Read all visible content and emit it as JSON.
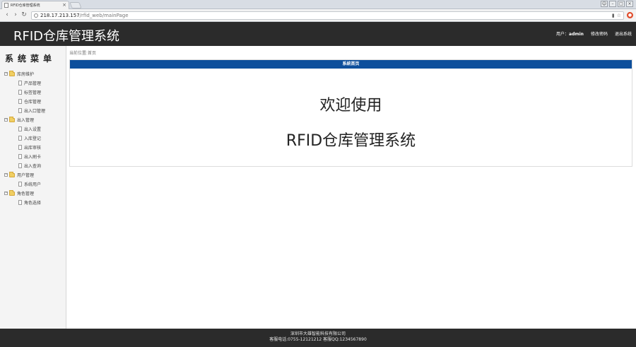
{
  "browser": {
    "tab_title": "RFID仓库管理系统",
    "tab_close": "×",
    "url_host": "218.17.213.157",
    "url_path": "/rfid_web/mainPage",
    "back": "‹",
    "forward": "›",
    "reload": "↻"
  },
  "header": {
    "title": "RFID仓库管理系统",
    "user_prefix": "用户：",
    "user_name": "admin",
    "link_password": "修改密码",
    "link_logout": "退出系统"
  },
  "sidebar": {
    "title": "系统菜单",
    "groups": [
      {
        "label": "库房维护",
        "items": [
          "产品管理",
          "标签管理",
          "仓库管理",
          "出入口管理"
        ]
      },
      {
        "label": "出入管理",
        "items": [
          "出入设置",
          "入库登记",
          "出库审核",
          "出入刷卡",
          "出入查询"
        ]
      },
      {
        "label": "用户管理",
        "items": [
          "系统用户"
        ]
      },
      {
        "label": "角色管理",
        "items": [
          "角色选择"
        ]
      }
    ]
  },
  "main": {
    "breadcrumb": "当前位置:首页",
    "panel_title": "系统首页",
    "welcome_line1": "欢迎使用",
    "welcome_line2": "RFID仓库管理系统"
  },
  "footer": {
    "company": "深圳市大雄智能科技有限公司",
    "contact": "客服电话:0755-12121212  客服QQ:1234567890"
  }
}
